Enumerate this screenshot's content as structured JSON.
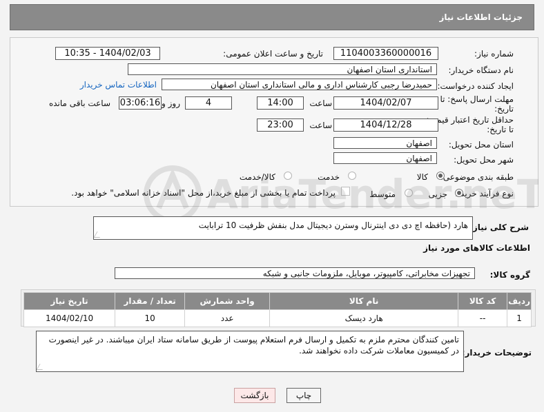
{
  "header": {
    "title": "جزئیات اطلاعات نیاز"
  },
  "form": {
    "need_number": {
      "label": "شماره نیاز:",
      "value": "1104003360000016"
    },
    "announce_datetime": {
      "label": "تاریخ و ساعت اعلان عمومی:",
      "value": "1404/02/03 - 10:35"
    },
    "buyer_org": {
      "label": "نام دستگاه خریدار:",
      "value": "استانداری استان اصفهان"
    },
    "creator": {
      "label": "ایجاد کننده درخواست:",
      "value": "حمیدرضا رجبی کارشناس اداری و مالی استانداری استان اصفهان",
      "contact_link": "اطلاعات تماس خریدار"
    },
    "reply_deadline": {
      "label_line1": "مهلت ارسال پاسخ: تا",
      "label_line2": "تاریخ:",
      "date": "1404/02/07",
      "time_label": "ساعت",
      "time": "14:00",
      "days": "4",
      "days_label": "روز و",
      "remaining": "03:06:16",
      "remaining_label": "ساعت باقی مانده"
    },
    "price_validity": {
      "label_line1": "حداقل تاریخ اعتبار قیمت:",
      "label_line2": "تا تاریخ:",
      "date": "1404/12/28",
      "time_label": "ساعت",
      "time": "23:00"
    },
    "delivery_province": {
      "label": "استان محل تحویل:",
      "value": "اصفهان"
    },
    "delivery_city": {
      "label": "شهر محل تحویل:",
      "value": "اصفهان"
    },
    "category": {
      "label": "طبقه بندی موضوعی:",
      "options": [
        "کالا",
        "خدمت",
        "کالا/خدمت"
      ],
      "selected": "کالا"
    },
    "purchase_type": {
      "label": "نوع فرآیند خرید :",
      "options": [
        "جزیی",
        "متوسط"
      ],
      "selected": "جزیی",
      "payment_note": "پرداخت تمام یا بخشی از مبلغ خرید،از محل \"اسناد خزانه اسلامی\" خواهد بود."
    }
  },
  "description": {
    "label": "شرح کلی نیاز:",
    "value": "هارد (حافظه اچ دی دی اینترنال وسترن دیجیتال مدل بنفش ظرفیت 10 ترابایت"
  },
  "goods_section": {
    "title": "اطلاعات کالاهای مورد نیاز",
    "group_label": "گروه کالا:",
    "group_value": "تجهیزات مخابراتی، کامپیوتر، موبایل، ملزومات جانبی و شبکه"
  },
  "table": {
    "headers": [
      "ردیف",
      "کد کالا",
      "نام کالا",
      "واحد شمارش",
      "تعداد / مقدار",
      "تاریخ نیاز"
    ],
    "rows": [
      [
        "1",
        "--",
        "هارد دیسک",
        "عدد",
        "10",
        "1404/02/10"
      ]
    ]
  },
  "buyer_notes": {
    "label": "توضیحات خریدار:",
    "value": "تامین کنندگان محترم ملزم به تکمیل و ارسال فرم استعلام پیوست از طریق سامانه ستاد ایران میباشند. در غیر اینصورت در کمیسیون معاملات شرکت داده نخواهند شد."
  },
  "buttons": {
    "print": "چاپ",
    "back": "بازگشت"
  },
  "watermark": {
    "text": "AriaTender.neT"
  }
}
